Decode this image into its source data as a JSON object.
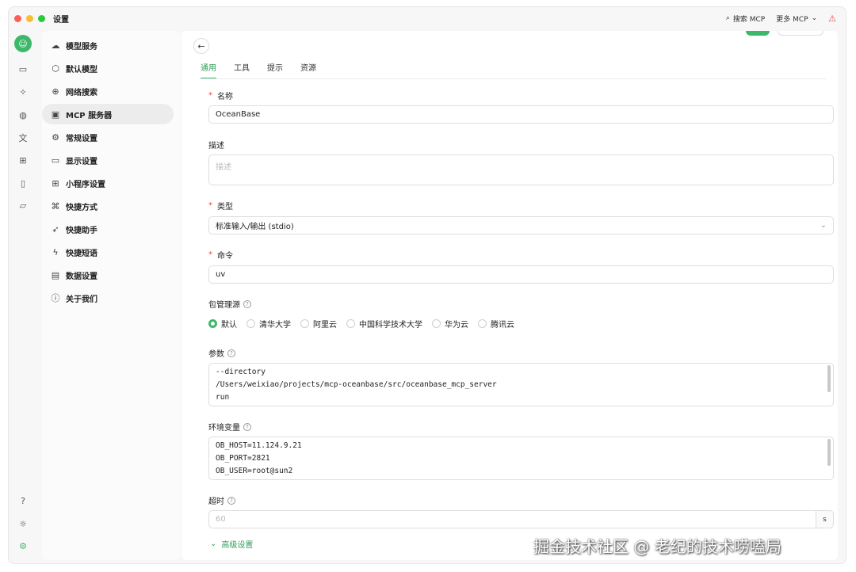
{
  "titlebar": {
    "title": "设置",
    "search_mcp": "搜索 MCP",
    "more_mcp": "更多 MCP"
  },
  "rail": {
    "icons": [
      "avatar-icon",
      "chat-icon",
      "sparkle-icon",
      "palette-icon",
      "translate-icon",
      "apps-icon",
      "document-icon",
      "folder-icon",
      "help-icon",
      "theme-icon",
      "settings-icon"
    ]
  },
  "menu": {
    "items": [
      {
        "label": "模型服务",
        "icon": "cloud-icon",
        "glyph": "☁"
      },
      {
        "label": "默认模型",
        "icon": "cube-icon",
        "glyph": "⬡"
      },
      {
        "label": "网络搜索",
        "icon": "globe-icon",
        "glyph": "⊕"
      },
      {
        "label": "MCP 服务器",
        "icon": "terminal-icon",
        "glyph": "▣"
      },
      {
        "label": "常规设置",
        "icon": "sliders-icon",
        "glyph": "⚙"
      },
      {
        "label": "显示设置",
        "icon": "monitor-icon",
        "glyph": "▭"
      },
      {
        "label": "小程序设置",
        "icon": "grid-icon",
        "glyph": "⊞"
      },
      {
        "label": "快捷方式",
        "icon": "command-icon",
        "glyph": "⌘"
      },
      {
        "label": "快捷助手",
        "icon": "rocket-icon",
        "glyph": "➶"
      },
      {
        "label": "快捷短语",
        "icon": "zap-icon",
        "glyph": "ϟ"
      },
      {
        "label": "数据设置",
        "icon": "storage-icon",
        "glyph": "▤"
      },
      {
        "label": "关于我们",
        "icon": "info-icon",
        "glyph": "ⓘ"
      }
    ]
  },
  "tabs": [
    "通用",
    "工具",
    "提示",
    "资源"
  ],
  "form": {
    "name_label": "名称",
    "name_value": "OceanBase",
    "desc_label": "描述",
    "desc_placeholder": "描述",
    "type_label": "类型",
    "type_value": "标准输入/输出 (stdio)",
    "command_label": "命令",
    "command_value": "uv",
    "registry_label": "包管理源",
    "registry_options": [
      "默认",
      "清华大学",
      "阿里云",
      "中国科学技术大学",
      "华为云",
      "腾讯云"
    ],
    "registry_selected": "默认",
    "args_label": "参数",
    "args_lines": [
      "--directory",
      "/Users/weixiao/projects/mcp-oceanbase/src/oceanbase_mcp_server",
      "run"
    ],
    "env_label": "环境变量",
    "env_lines": [
      "OB_HOST=11.124.9.21",
      "OB_PORT=2821",
      "OB_USER=root@sun2"
    ],
    "timeout_label": "超时",
    "timeout_placeholder": "60",
    "timeout_unit": "s",
    "advanced_label": "高级设置"
  },
  "watermark": "掘金技术社区 @ 老纪的技术唠嗑局",
  "colors": {
    "accent": "#3db86b",
    "required": "#e5484d"
  }
}
